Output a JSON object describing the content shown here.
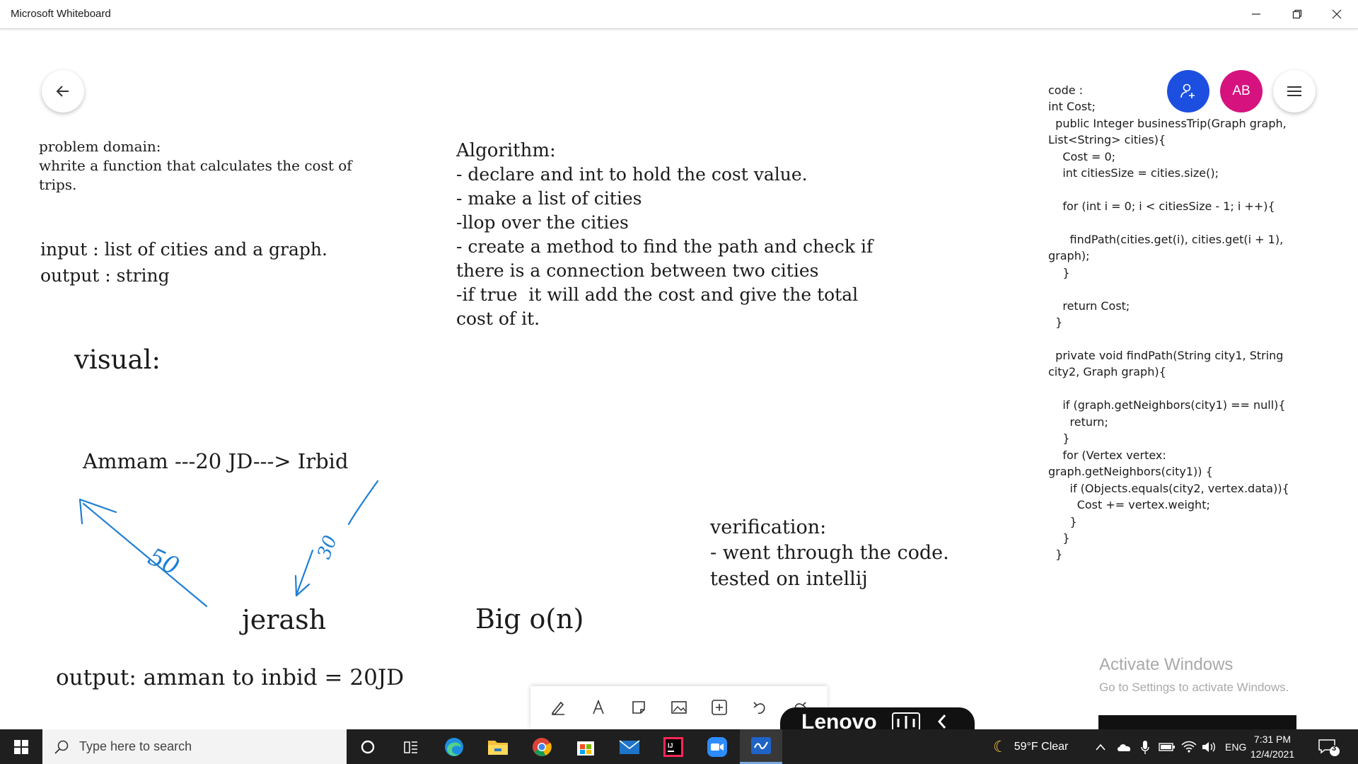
{
  "window": {
    "title": "Microsoft Whiteboard",
    "minimize_icon": "minimize-icon",
    "maximize_icon": "restore-icon",
    "close_icon": "close-icon"
  },
  "controls": {
    "back_icon": "arrow-left-icon",
    "share_icon": "add-person-icon",
    "avatar_initials": "AB",
    "menu_icon": "hamburger-icon",
    "share_color": "#1c4fe0",
    "avatar_color": "#d6127f"
  },
  "board": {
    "problem_domain": {
      "title": "problem domain:",
      "line1": "whrite a function that calculates the cost of",
      "line2": "trips."
    },
    "io": {
      "input": "input : list of cities and a graph.",
      "output": "output : string"
    },
    "algorithm": {
      "title": "Algorithm:",
      "lines": [
        "- declare and int to hold the cost value.",
        "- make a list of cities",
        "-llop over the cities",
        "- create a method to find the path and check if",
        "there is a connection between two cities",
        "-if true  it will add the cost and give the total",
        "cost of it."
      ]
    },
    "visual": {
      "title": "visual:",
      "edge_label": "Ammam ---20 JD---> Irbid",
      "node_jerash": "jerash",
      "label_50": "50",
      "label_30": "30",
      "output": "output: amman to inbid = 20JD"
    },
    "big_o": "Big o(n)",
    "verification": {
      "title": "verification:",
      "line1": "- went through the code.",
      "line2": "tested on intellij"
    },
    "code": [
      "code :",
      "int Cost;",
      "  public Integer businessTrip(Graph graph,",
      "List<String> cities){",
      "    Cost = 0;",
      "    int citiesSize = cities.size();",
      "",
      "    for (int i = 0; i < citiesSize - 1; i ++){",
      "",
      "      findPath(cities.get(i), cities.get(i + 1),",
      "graph);",
      "    }",
      "",
      "    return Cost;",
      "  }",
      "",
      "  private void findPath(String city1, String",
      "city2, Graph graph){",
      "",
      "    if (graph.getNeighbors(city1) == null){",
      "      return;",
      "    }",
      "    for (Vertex vertex:",
      "graph.getNeighbors(city1)) {",
      "      if (Objects.equals(city2, vertex.data)){",
      "        Cost += vertex.weight;",
      "      }",
      "    }",
      "  }"
    ]
  },
  "toolbar": {
    "tools": [
      "pen-icon",
      "text-icon",
      "sticky-note-icon",
      "image-icon",
      "add-icon",
      "undo-icon",
      "redo-icon"
    ]
  },
  "overlay": {
    "lenovo_text": "Lenovo",
    "activate_title": "Activate Windows",
    "activate_subtitle": "Go to Settings to activate Windows."
  },
  "taskbar": {
    "search_placeholder": "Type here to search",
    "apps": [
      "cortana-icon",
      "task-view-icon",
      "edge-icon",
      "file-explorer-icon",
      "chrome-icon",
      "store-icon",
      "mail-icon",
      "intellij-icon",
      "zoom-icon",
      "whiteboard-icon"
    ],
    "weather": "59°F  Clear",
    "language": "ENG",
    "time": "7:31 PM",
    "date": "12/4/2021",
    "notification_count": "3"
  }
}
